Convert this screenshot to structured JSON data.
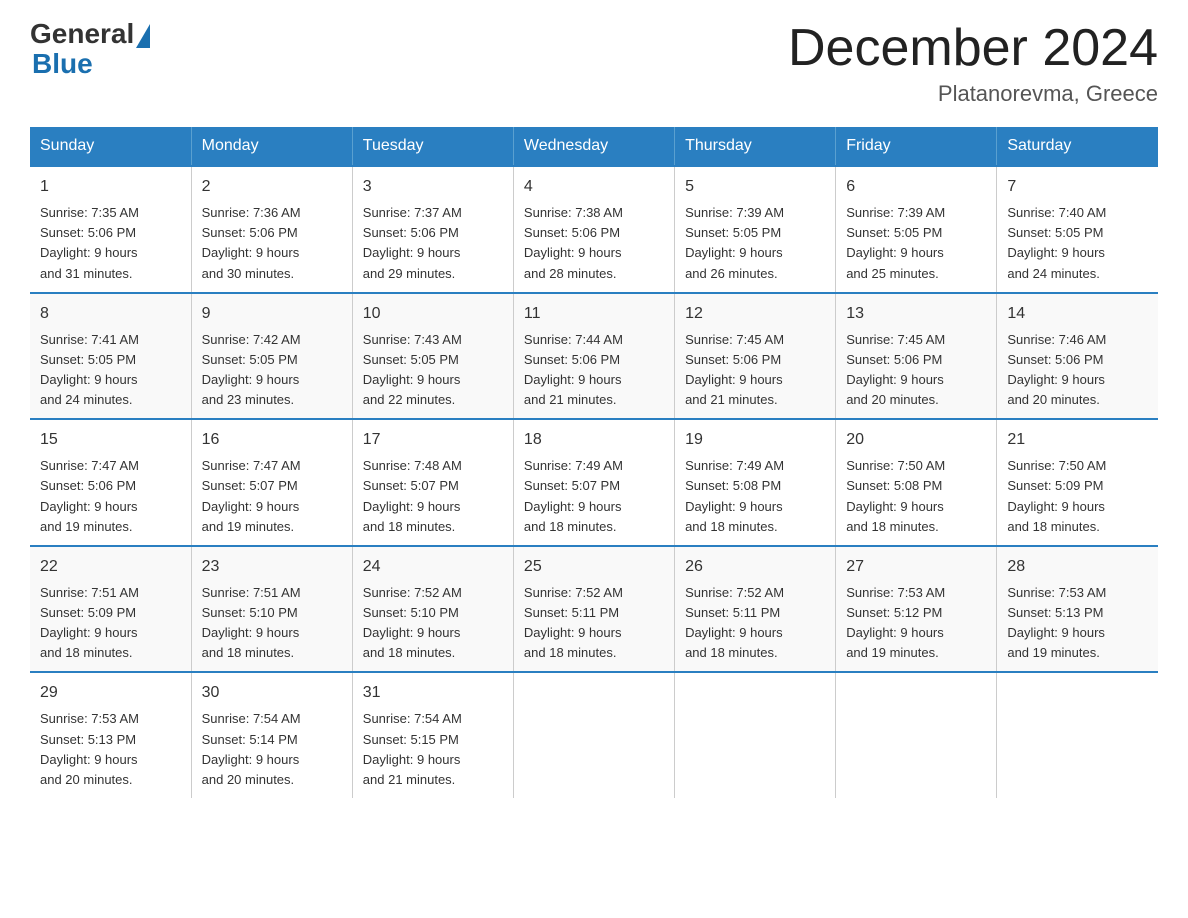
{
  "logo": {
    "general": "General",
    "blue": "Blue"
  },
  "title": "December 2024",
  "location": "Platanorevma, Greece",
  "days_header": [
    "Sunday",
    "Monday",
    "Tuesday",
    "Wednesday",
    "Thursday",
    "Friday",
    "Saturday"
  ],
  "weeks": [
    [
      {
        "day": "1",
        "sunrise": "7:35 AM",
        "sunset": "5:06 PM",
        "daylight": "9 hours and 31 minutes."
      },
      {
        "day": "2",
        "sunrise": "7:36 AM",
        "sunset": "5:06 PM",
        "daylight": "9 hours and 30 minutes."
      },
      {
        "day": "3",
        "sunrise": "7:37 AM",
        "sunset": "5:06 PM",
        "daylight": "9 hours and 29 minutes."
      },
      {
        "day": "4",
        "sunrise": "7:38 AM",
        "sunset": "5:06 PM",
        "daylight": "9 hours and 28 minutes."
      },
      {
        "day": "5",
        "sunrise": "7:39 AM",
        "sunset": "5:05 PM",
        "daylight": "9 hours and 26 minutes."
      },
      {
        "day": "6",
        "sunrise": "7:39 AM",
        "sunset": "5:05 PM",
        "daylight": "9 hours and 25 minutes."
      },
      {
        "day": "7",
        "sunrise": "7:40 AM",
        "sunset": "5:05 PM",
        "daylight": "9 hours and 24 minutes."
      }
    ],
    [
      {
        "day": "8",
        "sunrise": "7:41 AM",
        "sunset": "5:05 PM",
        "daylight": "9 hours and 24 minutes."
      },
      {
        "day": "9",
        "sunrise": "7:42 AM",
        "sunset": "5:05 PM",
        "daylight": "9 hours and 23 minutes."
      },
      {
        "day": "10",
        "sunrise": "7:43 AM",
        "sunset": "5:05 PM",
        "daylight": "9 hours and 22 minutes."
      },
      {
        "day": "11",
        "sunrise": "7:44 AM",
        "sunset": "5:06 PM",
        "daylight": "9 hours and 21 minutes."
      },
      {
        "day": "12",
        "sunrise": "7:45 AM",
        "sunset": "5:06 PM",
        "daylight": "9 hours and 21 minutes."
      },
      {
        "day": "13",
        "sunrise": "7:45 AM",
        "sunset": "5:06 PM",
        "daylight": "9 hours and 20 minutes."
      },
      {
        "day": "14",
        "sunrise": "7:46 AM",
        "sunset": "5:06 PM",
        "daylight": "9 hours and 20 minutes."
      }
    ],
    [
      {
        "day": "15",
        "sunrise": "7:47 AM",
        "sunset": "5:06 PM",
        "daylight": "9 hours and 19 minutes."
      },
      {
        "day": "16",
        "sunrise": "7:47 AM",
        "sunset": "5:07 PM",
        "daylight": "9 hours and 19 minutes."
      },
      {
        "day": "17",
        "sunrise": "7:48 AM",
        "sunset": "5:07 PM",
        "daylight": "9 hours and 18 minutes."
      },
      {
        "day": "18",
        "sunrise": "7:49 AM",
        "sunset": "5:07 PM",
        "daylight": "9 hours and 18 minutes."
      },
      {
        "day": "19",
        "sunrise": "7:49 AM",
        "sunset": "5:08 PM",
        "daylight": "9 hours and 18 minutes."
      },
      {
        "day": "20",
        "sunrise": "7:50 AM",
        "sunset": "5:08 PM",
        "daylight": "9 hours and 18 minutes."
      },
      {
        "day": "21",
        "sunrise": "7:50 AM",
        "sunset": "5:09 PM",
        "daylight": "9 hours and 18 minutes."
      }
    ],
    [
      {
        "day": "22",
        "sunrise": "7:51 AM",
        "sunset": "5:09 PM",
        "daylight": "9 hours and 18 minutes."
      },
      {
        "day": "23",
        "sunrise": "7:51 AM",
        "sunset": "5:10 PM",
        "daylight": "9 hours and 18 minutes."
      },
      {
        "day": "24",
        "sunrise": "7:52 AM",
        "sunset": "5:10 PM",
        "daylight": "9 hours and 18 minutes."
      },
      {
        "day": "25",
        "sunrise": "7:52 AM",
        "sunset": "5:11 PM",
        "daylight": "9 hours and 18 minutes."
      },
      {
        "day": "26",
        "sunrise": "7:52 AM",
        "sunset": "5:11 PM",
        "daylight": "9 hours and 18 minutes."
      },
      {
        "day": "27",
        "sunrise": "7:53 AM",
        "sunset": "5:12 PM",
        "daylight": "9 hours and 19 minutes."
      },
      {
        "day": "28",
        "sunrise": "7:53 AM",
        "sunset": "5:13 PM",
        "daylight": "9 hours and 19 minutes."
      }
    ],
    [
      {
        "day": "29",
        "sunrise": "7:53 AM",
        "sunset": "5:13 PM",
        "daylight": "9 hours and 20 minutes."
      },
      {
        "day": "30",
        "sunrise": "7:54 AM",
        "sunset": "5:14 PM",
        "daylight": "9 hours and 20 minutes."
      },
      {
        "day": "31",
        "sunrise": "7:54 AM",
        "sunset": "5:15 PM",
        "daylight": "9 hours and 21 minutes."
      },
      null,
      null,
      null,
      null
    ]
  ],
  "labels": {
    "sunrise": "Sunrise:",
    "sunset": "Sunset:",
    "daylight": "Daylight:"
  }
}
